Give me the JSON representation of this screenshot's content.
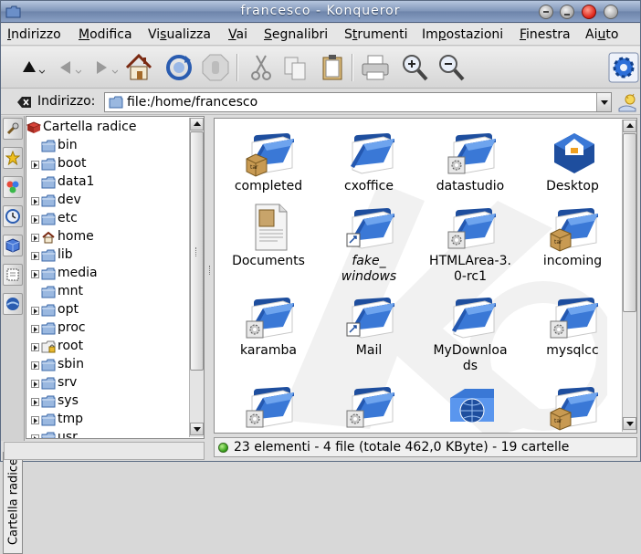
{
  "window": {
    "title": "francesco - Konqueror"
  },
  "menubar": {
    "items": [
      {
        "label": "Indirizzo",
        "accel": "I"
      },
      {
        "label": "Modifica",
        "accel": "M"
      },
      {
        "label": "Visualizza",
        "accel": "s"
      },
      {
        "label": "Vai",
        "accel": "V"
      },
      {
        "label": "Segnalibri",
        "accel": "S"
      },
      {
        "label": "Strumenti",
        "accel": "t"
      },
      {
        "label": "Impostazioni",
        "accel": "p"
      },
      {
        "label": "Finestra",
        "accel": "F"
      },
      {
        "label": "Aiuto",
        "accel": "u"
      }
    ]
  },
  "toolbar": {
    "icons": [
      "up-arrow-icon",
      "back-arrow-icon",
      "forward-arrow-icon",
      "home-icon",
      "reload-icon",
      "stop-icon",
      "cut-icon",
      "copy-icon",
      "paste-icon",
      "print-icon",
      "zoom-in-icon",
      "zoom-out-icon",
      "konqueror-gear-icon"
    ]
  },
  "location": {
    "label": "Indirizzo:",
    "value": "file:/home/francesco"
  },
  "sidebar": {
    "vertical_tab_label": "Cartella radice",
    "tree": [
      {
        "label": "Cartella radice",
        "root": true
      },
      {
        "label": "bin",
        "expandable": false
      },
      {
        "label": "boot",
        "expandable": true
      },
      {
        "label": "data1",
        "expandable": false
      },
      {
        "label": "dev",
        "expandable": true
      },
      {
        "label": "etc",
        "expandable": true
      },
      {
        "label": "home",
        "expandable": true,
        "icon": "home"
      },
      {
        "label": "lib",
        "expandable": true
      },
      {
        "label": "media",
        "expandable": true
      },
      {
        "label": "mnt",
        "expandable": false
      },
      {
        "label": "opt",
        "expandable": true
      },
      {
        "label": "proc",
        "expandable": true
      },
      {
        "label": "root",
        "expandable": true,
        "icon": "locked"
      },
      {
        "label": "sbin",
        "expandable": true
      },
      {
        "label": "srv",
        "expandable": true
      },
      {
        "label": "sys",
        "expandable": true
      },
      {
        "label": "tmp",
        "expandable": true
      },
      {
        "label": "usr",
        "expandable": true
      }
    ]
  },
  "files": [
    {
      "label": "completed",
      "icon": "folder-tar"
    },
    {
      "label": "cxoffice",
      "icon": "folder"
    },
    {
      "label": "datastudio",
      "icon": "folder-gear"
    },
    {
      "label": "Desktop",
      "icon": "desktop"
    },
    {
      "label": "Documents",
      "icon": "document"
    },
    {
      "label": "fake_\nwindows",
      "icon": "folder-link",
      "italic": true
    },
    {
      "label": "HTMLArea-3.\n0-rc1",
      "icon": "folder-gear"
    },
    {
      "label": "incoming",
      "icon": "folder-tar"
    },
    {
      "label": "karamba",
      "icon": "folder-gear"
    },
    {
      "label": "Mail",
      "icon": "folder-link"
    },
    {
      "label": "MyDownloa\nds",
      "icon": "folder"
    },
    {
      "label": "mysqlcc",
      "icon": "folder-gear"
    },
    {
      "label": "",
      "icon": "folder-gear"
    },
    {
      "label": "",
      "icon": "folder-gear"
    },
    {
      "label": "",
      "icon": "folder-globe"
    },
    {
      "label": "",
      "icon": "folder-tar"
    }
  ],
  "status": {
    "text": "23 elementi - 4 file (totale 462,0 KByte) - 19 cartelle"
  },
  "colors": {
    "titlebar": "#7f95b8",
    "folder_blue": "#2f62b8",
    "selection": "#3a6ea5"
  }
}
